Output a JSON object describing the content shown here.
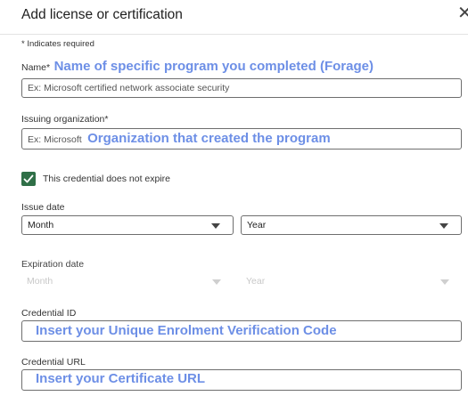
{
  "dialog": {
    "title": "Add license or certification",
    "close_icon": "close-icon",
    "required_note": "* Indicates required"
  },
  "name": {
    "label": "Name*",
    "annotation": "Name of specific program you completed (Forage)",
    "placeholder": "Ex: Microsoft certified network associate security",
    "value": ""
  },
  "issuing_org": {
    "label": "Issuing organization*",
    "placeholder": "Ex: Microsoft",
    "annotation": "Organization that created the program",
    "value": ""
  },
  "no_expire": {
    "label": "This credential does not expire",
    "checked": true,
    "icon": "checkmark-icon",
    "color": "#2f6f47"
  },
  "issue_date": {
    "label": "Issue date",
    "month": "Month",
    "year": "Year"
  },
  "expiration_date": {
    "label": "Expiration date",
    "month": "Month",
    "year": "Year"
  },
  "credential_id": {
    "label": "Credential ID",
    "annotation": "Insert your Unique Enrolment Verification Code"
  },
  "credential_url": {
    "label": "Credential URL",
    "annotation": "Insert your Certificate URL"
  },
  "colors": {
    "annotation": "#6d8fe6",
    "checkbox": "#2f6f47"
  }
}
